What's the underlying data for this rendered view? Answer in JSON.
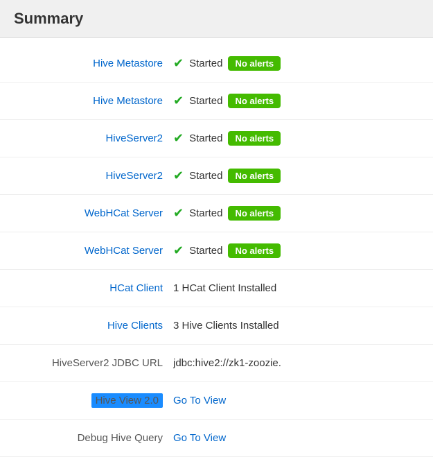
{
  "header": {
    "title": "Summary"
  },
  "rows": [
    {
      "id": "hive-metastore-1",
      "label": "Hive Metastore",
      "label_type": "link",
      "status": "Started",
      "badge": "No alerts",
      "show_badge": true,
      "show_link": false
    },
    {
      "id": "hive-metastore-2",
      "label": "Hive Metastore",
      "label_type": "link",
      "status": "Started",
      "badge": "No alerts",
      "show_badge": true,
      "show_link": false
    },
    {
      "id": "hiveserver2-1",
      "label": "HiveServer2",
      "label_type": "link",
      "status": "Started",
      "badge": "No alerts",
      "show_badge": true,
      "show_link": false
    },
    {
      "id": "hiveserver2-2",
      "label": "HiveServer2",
      "label_type": "link",
      "status": "Started",
      "badge": "No alerts",
      "show_badge": true,
      "show_link": false
    },
    {
      "id": "webhcat-server-1",
      "label": "WebHCat Server",
      "label_type": "link",
      "status": "Started",
      "badge": "No alerts",
      "show_badge": true,
      "show_link": false
    },
    {
      "id": "webhcat-server-2",
      "label": "WebHCat Server",
      "label_type": "link",
      "status": "Started",
      "badge": "No alerts",
      "show_badge": true,
      "show_link": false
    },
    {
      "id": "hcat-client",
      "label": "HCat Client",
      "label_type": "link",
      "status": "1 HCat Client Installed",
      "badge": "",
      "show_badge": false,
      "show_link": false
    },
    {
      "id": "hive-clients",
      "label": "Hive Clients",
      "label_type": "link",
      "status": "3 Hive Clients Installed",
      "badge": "",
      "show_badge": false,
      "show_link": false
    },
    {
      "id": "jdbc-url",
      "label": "HiveServer2 JDBC URL",
      "label_type": "text",
      "status": "jdbc:hive2://zk1-zoozie.",
      "badge": "",
      "show_badge": false,
      "show_link": false
    },
    {
      "id": "hive-view",
      "label": "Hive View 2.0",
      "label_type": "highlight",
      "status": "",
      "badge": "",
      "show_badge": false,
      "show_link": true,
      "link_text": "Go To View"
    },
    {
      "id": "debug-hive-query",
      "label": "Debug Hive Query",
      "label_type": "text",
      "status": "",
      "badge": "",
      "show_badge": false,
      "show_link": true,
      "link_text": "Go To View"
    }
  ],
  "icons": {
    "check": "✔"
  }
}
